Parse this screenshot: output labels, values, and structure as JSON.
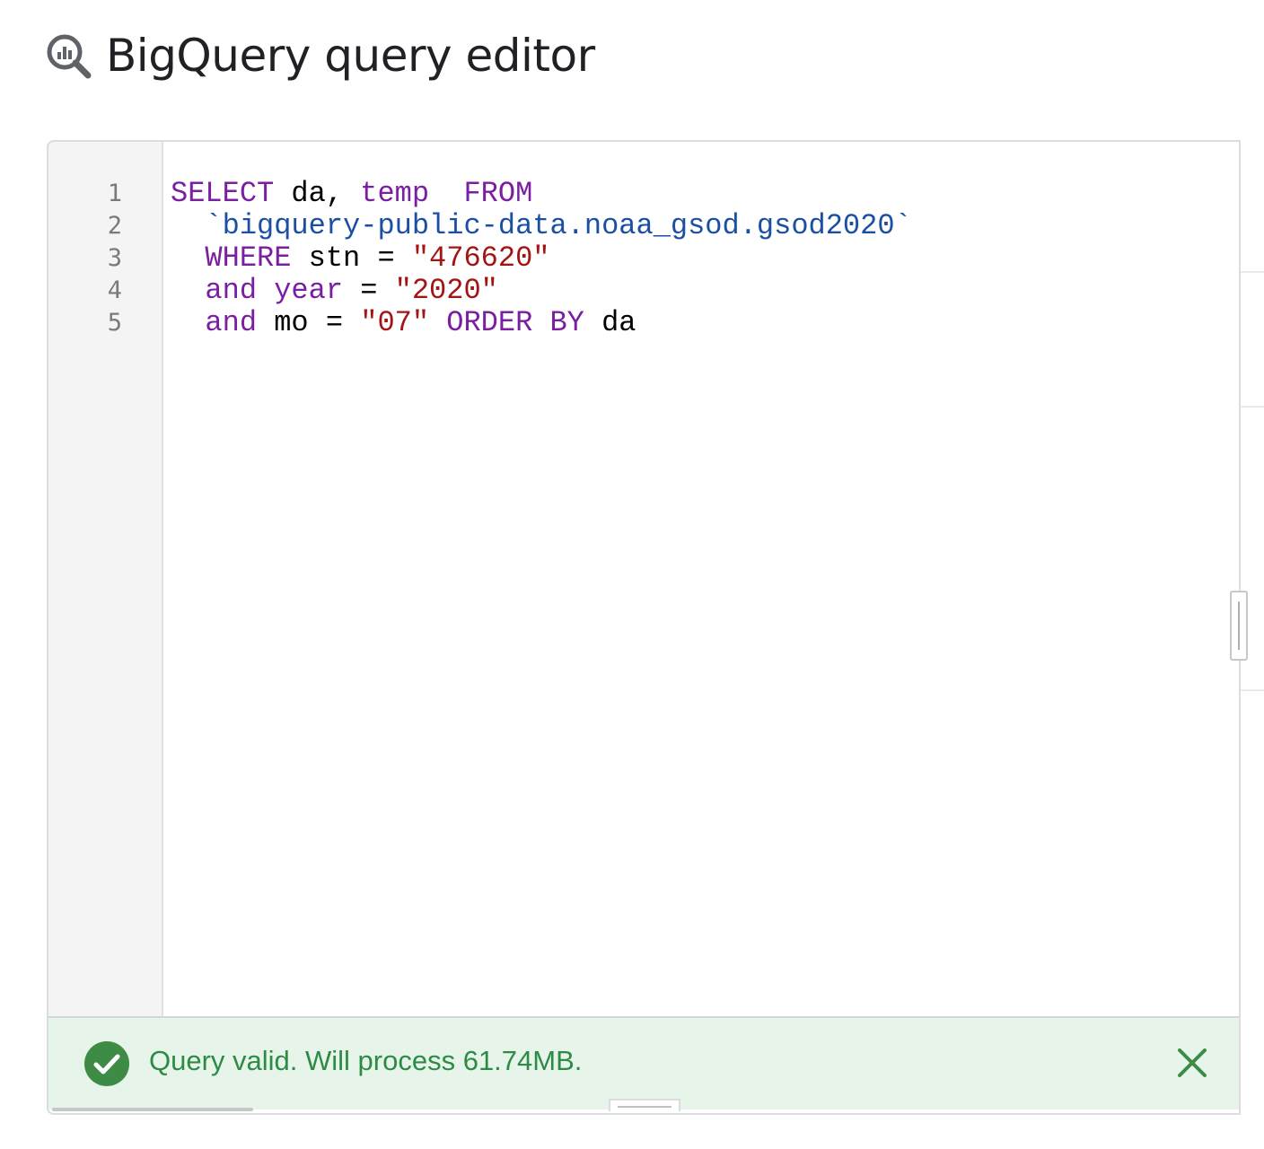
{
  "header": {
    "title": "BigQuery query editor",
    "icon": "bigquery-icon"
  },
  "editor": {
    "line_numbers": [
      "1",
      "2",
      "3",
      "4",
      "5"
    ],
    "lines": [
      [
        {
          "t": "SELECT",
          "c": "kw"
        },
        {
          "t": " da, ",
          "c": "id"
        },
        {
          "t": "temp",
          "c": "kw"
        },
        {
          "t": "  ",
          "c": "id"
        },
        {
          "t": "FROM",
          "c": "kw"
        }
      ],
      [
        {
          "t": "  `bigquery-public-data.noaa_gsod.gsod2020`",
          "c": "tbl"
        }
      ],
      [
        {
          "t": "  ",
          "c": "id"
        },
        {
          "t": "WHERE",
          "c": "kw"
        },
        {
          "t": " stn = ",
          "c": "id"
        },
        {
          "t": "\"476620\"",
          "c": "str"
        }
      ],
      [
        {
          "t": "  ",
          "c": "id"
        },
        {
          "t": "and",
          "c": "kw"
        },
        {
          "t": " ",
          "c": "id"
        },
        {
          "t": "year",
          "c": "kw"
        },
        {
          "t": " = ",
          "c": "id"
        },
        {
          "t": "\"2020\"",
          "c": "str"
        }
      ],
      [
        {
          "t": "  ",
          "c": "id"
        },
        {
          "t": "and",
          "c": "kw"
        },
        {
          "t": " mo = ",
          "c": "id"
        },
        {
          "t": "\"07\"",
          "c": "str"
        },
        {
          "t": " ",
          "c": "id"
        },
        {
          "t": "ORDER BY",
          "c": "kw"
        },
        {
          "t": " da",
          "c": "id"
        }
      ]
    ],
    "colors": {
      "keyword": "#7b1fa2",
      "table": "#1a4fa3",
      "string": "#a31515",
      "identifier": "#000000"
    }
  },
  "validator": {
    "status": "valid",
    "message": "Query valid. Will process 61.74MB.",
    "status_icon": "check-circle-icon",
    "close_icon": "close-icon",
    "colors": {
      "background": "#e6f4ea",
      "accent": "#34a853"
    }
  }
}
